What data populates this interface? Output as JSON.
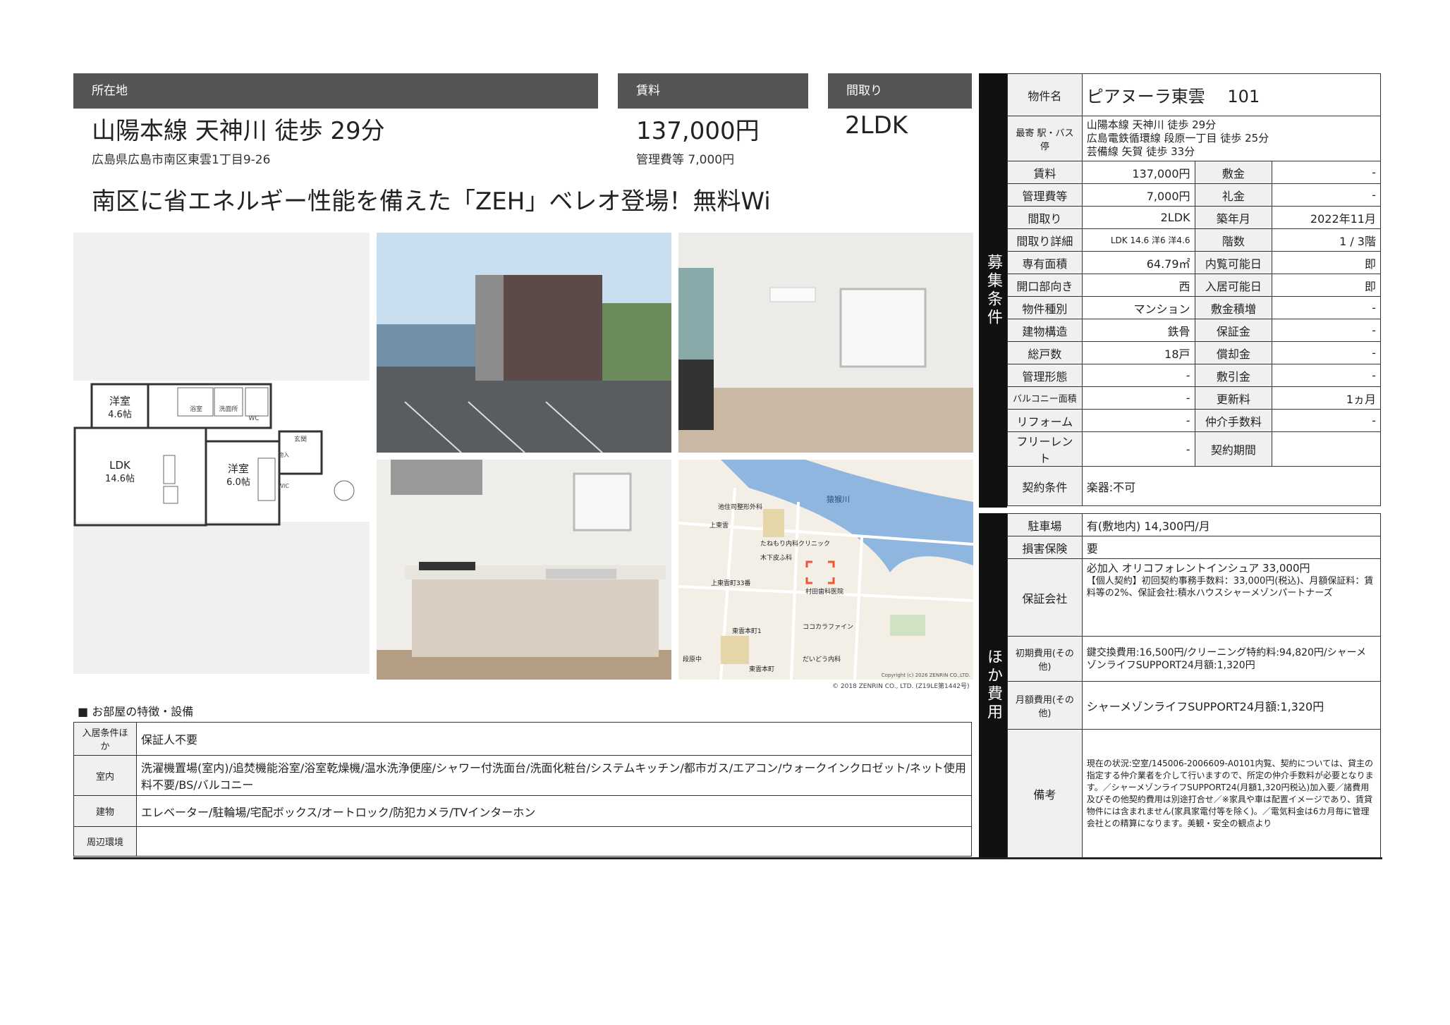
{
  "headers": {
    "location": "所在地",
    "rent": "賃料",
    "layout": "間取り"
  },
  "summary": {
    "access": "山陽本線 天神川 徒歩 29分",
    "address": "広島県広島市南区東雲1丁目9-26",
    "rent": "137,000円",
    "fee": "管理費等 7,000円",
    "layout": "2LDK",
    "catch": "南区に省エネルギー性能を備えた「ZEH」ベレオ登場！無料Wi"
  },
  "floorplan": {
    "rooms": [
      "洋室\n4.6帖",
      "LDK\n14.6帖",
      "洋室\n6.0帖"
    ],
    "labels": {
      "bath": "浴室",
      "wash": "洗面所",
      "wc": "WC",
      "entrance": "玄関",
      "storage": "物入",
      "wic": "WIC"
    }
  },
  "map": {
    "labels": [
      "猿猴川",
      "池住司整形外科",
      "たねもり内科クリニック",
      "木下皮ふ科",
      "村田歯科医院",
      "ココカラファイン",
      "だいどう内科",
      "段原中",
      "上東雲",
      "東雲本町1",
      "上東雲町33番",
      "東雲本町"
    ],
    "copyright_small": "Copyright (c) 2026 ZENRIN CO.,LTD.",
    "copyright": "© 2018 ZENRIN CO., LTD. (Z19LE第1442号)"
  },
  "sidebars": {
    "recruit": "募集条件",
    "other": "ほか費用"
  },
  "property": {
    "name_label": "物件名",
    "name": "ピアヌーラ東雲　 101",
    "station_label": "最寄 駅・バス停",
    "stations": [
      "山陽本線 天神川 徒歩 29分",
      "広島電鉄循環線 段原一丁目 徒歩 25分",
      "芸備線 矢賀 徒歩 33分"
    ]
  },
  "rows": [
    {
      "l1": "賃料",
      "v1": "137,000円",
      "l2": "敷金",
      "v2": "-"
    },
    {
      "l1": "管理費等",
      "v1": "7,000円",
      "l2": "礼金",
      "v2": "-"
    },
    {
      "l1": "間取り",
      "v1": "2LDK",
      "l2": "築年月",
      "v2": "2022年11月"
    },
    {
      "l1": "間取り詳細",
      "v1": "LDK 14.6 洋6 洋4.6",
      "l2": "階数",
      "v2": "1 / 3階"
    },
    {
      "l1": "専有面積",
      "v1": "64.79㎡",
      "l2": "内覧可能日",
      "v2": "即"
    },
    {
      "l1": "開口部向き",
      "v1": "西",
      "l2": "入居可能日",
      "v2": "即"
    },
    {
      "l1": "物件種別",
      "v1": "マンション",
      "l2": "敷金積増",
      "v2": "-"
    },
    {
      "l1": "建物構造",
      "v1": "鉄骨",
      "l2": "保証金",
      "v2": "-"
    },
    {
      "l1": "総戸数",
      "v1": "18戸",
      "l2": "償却金",
      "v2": "-"
    },
    {
      "l1": "管理形態",
      "v1": "-",
      "l2": "敷引金",
      "v2": "-"
    },
    {
      "l1": "バルコニー面積",
      "v1": "-",
      "l2": "更新料",
      "v2": "1ヵ月"
    },
    {
      "l1": "リフォーム",
      "v1": "-",
      "l2": "仲介手数料",
      "v2": "-"
    },
    {
      "l1": "フリーレント",
      "v1": "-",
      "l2": "契約期間",
      "v2": ""
    }
  ],
  "contract": {
    "label": "契約条件",
    "value": "楽器:不可"
  },
  "costs": {
    "parking_label": "駐車場",
    "parking": "有(敷地内) 14,300円/月",
    "insurance_label": "損害保険",
    "insurance": "要",
    "guarantor_label": "保証会社",
    "guarantor_main": "必加入 オリコフォレントインシュア 33,000円",
    "guarantor_detail": "【個人契約】初回契約事務手数料：33,000円(税込)、月額保証料：賃料等の2%、保証会社:積水ハウスシャーメゾンパートナーズ",
    "initial_label": "初期費用(その他)",
    "initial": "鍵交換費用:16,500円/クリーニング特約料:94,820円/シャーメゾンライフSUPPORT24月額:1,320円",
    "monthly_label": "月額費用(その他)",
    "monthly": "シャーメゾンライフSUPPORT24月額:1,320円",
    "remarks_label": "備考",
    "remarks": "現在の状況:空室/145006-2006609-A0101内覧、契約については、貸主の指定する仲介業者を介して行いますので、所定の仲介手数料が必要となります。／シャーメゾンライフSUPPORT24(月額1,320円税込)加入要／諸費用及びその他契約費用は別途打合せ／※家具や車は配置イメージであり、賃貸物件には含まれません(家具家電付等を除く)。／電気料金は6カ月毎に管理会社との精算になります。美観・安全の観点より"
  },
  "features": {
    "title": "■ お部屋の特徴・設備",
    "rows": [
      {
        "label": "入居条件ほか",
        "value": "保証人不要"
      },
      {
        "label": "室内",
        "value": "洗濯機置場(室内)/追焚機能浴室/浴室乾燥機/温水洗浄便座/シャワー付洗面台/洗面化粧台/システムキッチン/都市ガス/エアコン/ウォークインクロゼット/ネット使用料不要/BS/バルコニー"
      },
      {
        "label": "建物",
        "value": "エレベーター/駐輪場/宅配ボックス/オートロック/防犯カメラ/TVインターホン"
      },
      {
        "label": "周辺環境",
        "value": ""
      }
    ]
  }
}
